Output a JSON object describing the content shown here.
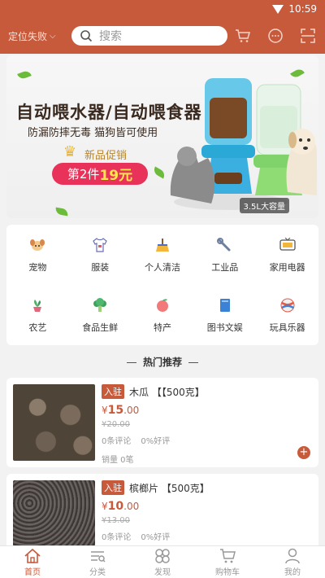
{
  "status": {
    "time": "10:59"
  },
  "header": {
    "location": "定位失败",
    "search_placeholder": "搜索",
    "icons": [
      "cart-icon",
      "message-icon",
      "scan-icon"
    ]
  },
  "banner": {
    "headline": "自动喂水器/自动喂食器",
    "subline": "防漏防摔无毒 猫狗皆可使用",
    "promo": "新品促销",
    "pill_prefix": "第2件",
    "pill_price": "19元",
    "capacity": "3.5L大容量"
  },
  "categories": [
    {
      "label": "宠物",
      "icon": "dog-icon"
    },
    {
      "label": "服装",
      "icon": "shirt-icon"
    },
    {
      "label": "个人清洁",
      "icon": "broom-icon"
    },
    {
      "label": "工业品",
      "icon": "wrench-icon"
    },
    {
      "label": "家用电器",
      "icon": "tv-icon"
    },
    {
      "label": "农艺",
      "icon": "plant-icon"
    },
    {
      "label": "食品生鲜",
      "icon": "broccoli-icon"
    },
    {
      "label": "特产",
      "icon": "peach-icon"
    },
    {
      "label": "图书文娱",
      "icon": "book-icon"
    },
    {
      "label": "玩具乐器",
      "icon": "ball-icon"
    }
  ],
  "section_title": "热门推荐",
  "products": [
    {
      "badge": "入驻",
      "name": "木瓜 【【500克】",
      "currency": "¥",
      "price": "15",
      "price_decimal": ".00",
      "old_price": "¥20.00",
      "comments": "0条评论",
      "good_rate": "0%好评",
      "sold": "销量 0笔"
    },
    {
      "badge": "入驻",
      "name": "槟榔片 【500克】",
      "currency": "¥",
      "price": "10",
      "price_decimal": ".00",
      "old_price": "¥13.00",
      "comments": "0条评论",
      "good_rate": "0%好评",
      "sold": ""
    }
  ],
  "tabs": [
    {
      "label": "首页",
      "icon": "home-icon",
      "active": true
    },
    {
      "label": "分类",
      "icon": "category-icon",
      "active": false
    },
    {
      "label": "发现",
      "icon": "discover-icon",
      "active": false
    },
    {
      "label": "购物车",
      "icon": "cart-icon",
      "active": false
    },
    {
      "label": "我的",
      "icon": "user-icon",
      "active": false
    }
  ],
  "colors": {
    "brand": "#c85a3c",
    "promo_pill": "#e8325a"
  }
}
